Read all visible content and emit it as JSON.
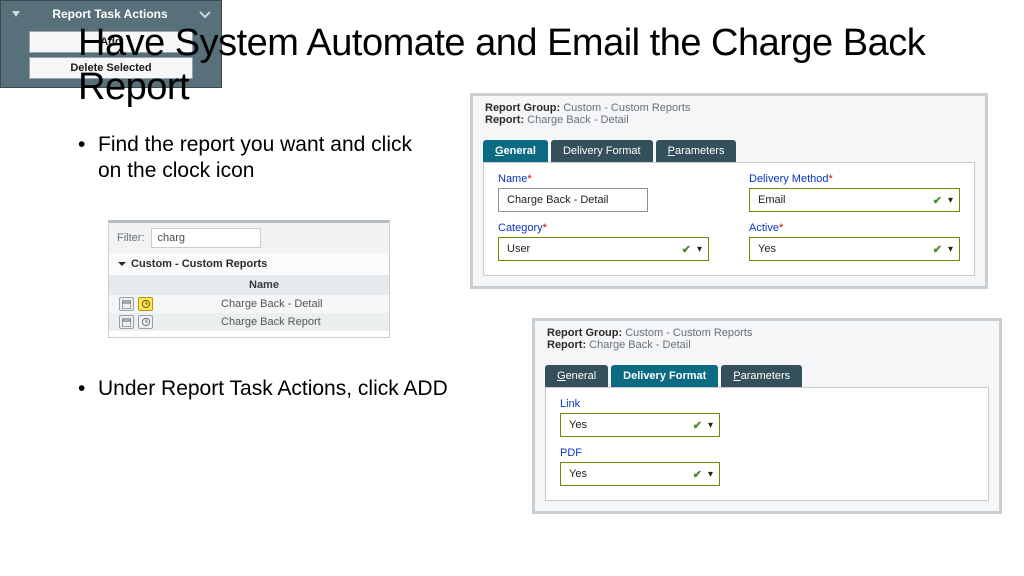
{
  "title": "Have System Automate and Email the Charge Back Report",
  "bullets": {
    "b1": "Find the report you want and click on the clock icon",
    "b2": "Under Report Task Actions, click ADD"
  },
  "shot1": {
    "filter_label": "Filter:",
    "filter_value": "charg",
    "group_label": "Custom - Custom Reports",
    "col_name": "Name",
    "rows": [
      "Charge Back - Detail",
      "Charge Back Report"
    ]
  },
  "shot2": {
    "header": "Report Task Actions",
    "add": "Add",
    "delete": "Delete Selected"
  },
  "pane3": {
    "report_group_label": "Report Group:",
    "report_group_value": "Custom - Custom Reports",
    "report_label": "Report:",
    "report_value": "Charge Back - Detail",
    "tabs": {
      "t1": {
        "pre": "G",
        "rest": "eneral"
      },
      "t2": "Delivery Format",
      "t3": {
        "pre": "P",
        "rest": "arameters"
      }
    },
    "fields": {
      "name": {
        "label": "Name",
        "value": "Charge Back - Detail"
      },
      "delivery": {
        "label": "Delivery Method",
        "value": "Email"
      },
      "category": {
        "label": "Category",
        "value": "User"
      },
      "active": {
        "label": "Active",
        "value": "Yes"
      }
    }
  },
  "pane4": {
    "report_group_label": "Report Group:",
    "report_group_value": "Custom - Custom Reports",
    "report_label": "Report:",
    "report_value": "Charge Back - Detail",
    "tabs": {
      "t1": {
        "pre": "G",
        "rest": "eneral"
      },
      "t2": "Delivery Format",
      "t3": {
        "pre": "P",
        "rest": "arameters"
      }
    },
    "fields": {
      "link": {
        "label": "Link",
        "value": "Yes"
      },
      "pdf": {
        "label": "PDF",
        "value": "Yes"
      }
    }
  }
}
